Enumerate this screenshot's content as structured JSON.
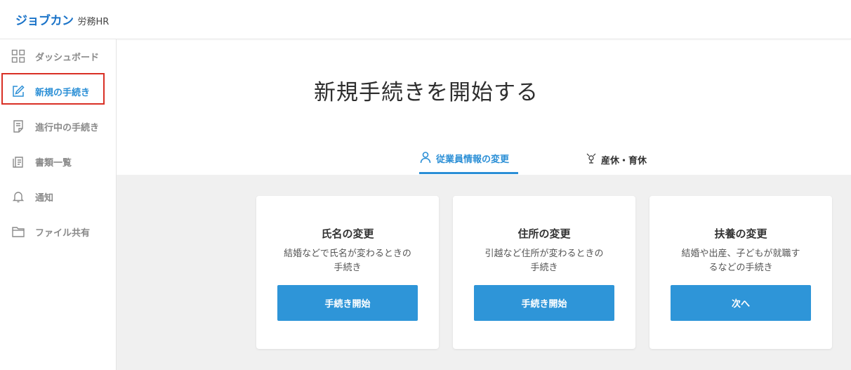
{
  "header": {
    "brand": "ジョブカン",
    "product": "労務HR"
  },
  "sidebar": {
    "items": [
      {
        "label": "ダッシュボード",
        "icon": "dashboard-grid-icon"
      },
      {
        "label": "新規の手続き",
        "icon": "edit-icon",
        "active": true
      },
      {
        "label": "進行中の手続き",
        "icon": "document-list-icon"
      },
      {
        "label": "書類一覧",
        "icon": "documents-icon"
      },
      {
        "label": "通知",
        "icon": "bell-icon"
      },
      {
        "label": "ファイル共有",
        "icon": "folder-icon"
      }
    ]
  },
  "main": {
    "title": "新規手続きを開始する",
    "tabs": [
      {
        "label": "従業員情報の変更",
        "icon": "person-icon",
        "active": true
      },
      {
        "label": "産休・育休",
        "icon": "baby-icon",
        "active": false
      }
    ],
    "cards": [
      {
        "title": "氏名の変更",
        "desc_line1": "結婚などで氏名が変わるときの",
        "desc_line2": "手続き",
        "button": "手続き開始"
      },
      {
        "title": "住所の変更",
        "desc_line1": "引越など住所が変わるときの",
        "desc_line2": "手続き",
        "button": "手続き開始"
      },
      {
        "title": "扶養の変更",
        "desc_line1": "結婚や出産、子どもが就職す",
        "desc_line2": "るなどの手続き",
        "button": "次へ"
      }
    ]
  },
  "colors": {
    "accent": "#2b8fd6",
    "button": "#2e95d8",
    "brand": "#1a73c8",
    "highlight": "#d93025",
    "content_bg": "#f0f0f0"
  }
}
